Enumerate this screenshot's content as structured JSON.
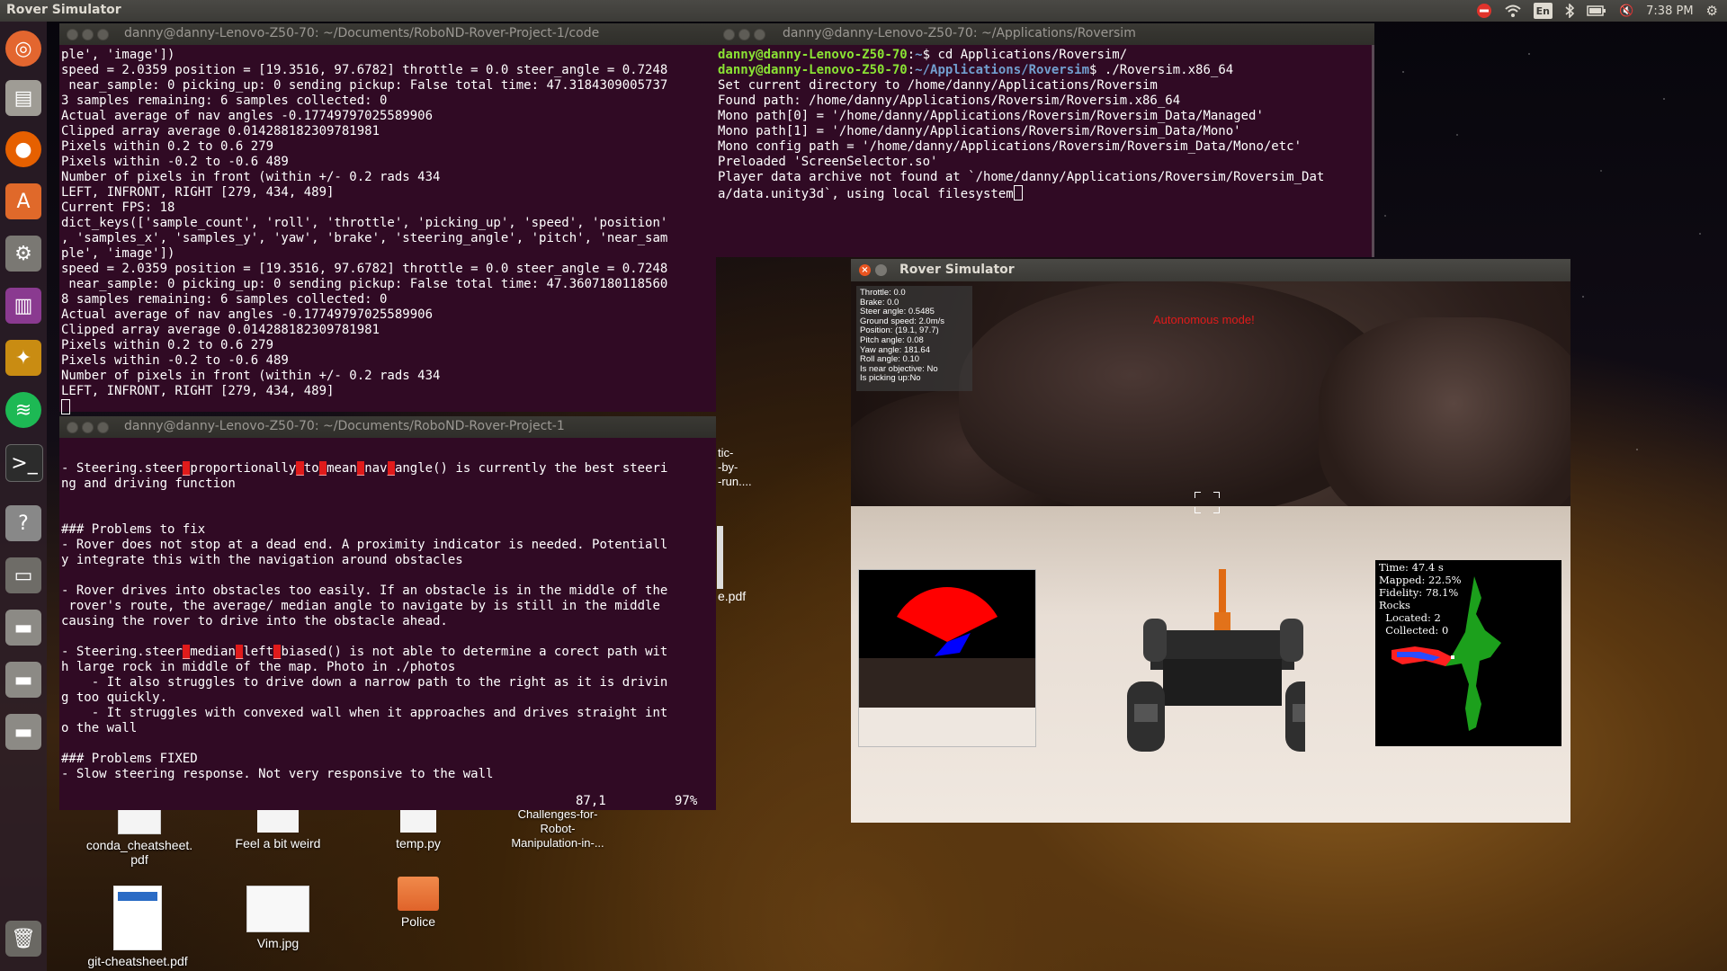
{
  "top_panel": {
    "app_title": "Rover Simulator",
    "keyboard_layout": "En",
    "time": "7:38 PM"
  },
  "launcher": {
    "items": [
      "ubuntu-dash-icon",
      "files-icon",
      "firefox-icon",
      "software-center-icon",
      "settings-icon",
      "workspace-icon",
      "puzzle-icon",
      "spotify-icon",
      "terminal-icon",
      "help-icon",
      "window-icon",
      "drive-icon",
      "drive-icon",
      "drive-icon",
      "trash-icon"
    ]
  },
  "term1": {
    "title": "danny@danny-Lenovo-Z50-70: ~/Documents/RoboND-Rover-Project-1/code",
    "lines": [
      "ple', 'image'])",
      "speed = 2.0359 position = [19.3516, 97.6782] throttle = 0.0 steer_angle = 0.7248",
      " near_sample: 0 picking_up: 0 sending pickup: False total time: 47.3184309005737",
      "3 samples remaining: 6 samples collected: 0",
      "Actual average of nav angles -0.17749797025589906",
      "Clipped array average 0.014288182309781981",
      "Pixels within 0.2 to 0.6 279",
      "Pixels within -0.2 to -0.6 489",
      "Number of pixels in front (within +/- 0.2 rads 434",
      "LEFT, INFRONT, RIGHT [279, 434, 489]",
      "Current FPS: 18",
      "dict_keys(['sample_count', 'roll', 'throttle', 'picking_up', 'speed', 'position'",
      ", 'samples_x', 'samples_y', 'yaw', 'brake', 'steering_angle', 'pitch', 'near_sam",
      "ple', 'image'])",
      "speed = 2.0359 position = [19.3516, 97.6782] throttle = 0.0 steer_angle = 0.7248",
      " near_sample: 0 picking_up: 0 sending pickup: False total time: 47.3607180118560",
      "8 samples remaining: 6 samples collected: 0",
      "Actual average of nav angles -0.17749797025589906",
      "Clipped array average 0.014288182309781981",
      "Pixels within 0.2 to 0.6 279",
      "Pixels within -0.2 to -0.6 489",
      "Number of pixels in front (within +/- 0.2 rads 434",
      "LEFT, INFRONT, RIGHT [279, 434, 489]"
    ]
  },
  "term2": {
    "title": "danny@danny-Lenovo-Z50-70: ~/Applications/Roversim",
    "prompt_user": "danny@danny-Lenovo-Z50-70",
    "cmd1_path": "~",
    "cmd1": "$ cd Applications/Roversim/",
    "cmd2_path": "~/Applications/Roversim",
    "cmd2": "$ ./Roversim.x86_64",
    "lines": [
      "Set current directory to /home/danny/Applications/Roversim",
      "Found path: /home/danny/Applications/Roversim/Roversim.x86_64",
      "Mono path[0] = '/home/danny/Applications/Roversim/Roversim_Data/Managed'",
      "Mono path[1] = '/home/danny/Applications/Roversim/Roversim_Data/Mono'",
      "Mono config path = '/home/danny/Applications/Roversim/Roversim_Data/Mono/etc'",
      "Preloaded 'ScreenSelector.so'",
      "Player data archive not found at `/home/danny/Applications/Roversim/Roversim_Dat"
    ],
    "last_line": "a/data.unity3d`, using local filesystem"
  },
  "term3": {
    "title": "danny@danny-Lenovo-Z50-70: ~/Documents/RoboND-Rover-Project-1",
    "status_pos": "87,1",
    "status_pct": "97%",
    "lines": [
      "",
      "- Steering.steer_proportionally_to_mean_nav_angle() is currently the best steeri",
      "ng and driving function",
      "",
      "",
      "### Problems to fix",
      "- Rover does not stop at a dead end. A proximity indicator is needed. Potentiall",
      "y integrate this with the navigation around obstacles",
      "",
      "- Rover drives into obstacles too easily. If an obstacle is in the middle of the",
      " rover's route, the average/ median angle to navigate by is still in the middle",
      "causing the rover to drive into the obstacle ahead.",
      "",
      "- Steering.steer_median_left_biased() is not able to determine a corect path wit",
      "h large rock in middle of the map. Photo in ./photos",
      "    - It also struggles to drive down a narrow path to the right as it is drivin",
      "g too quickly.",
      "    - It struggles with convexed wall when it approaches and drives straight int",
      "o the wall",
      "",
      "### Problems FIXED",
      "- Slow steering response. Not very responsive to the wall"
    ]
  },
  "partial_desktop": {
    "line1": "tic-",
    "line2": "-by-",
    "line3": "-run....",
    "pdf": "e.pdf"
  },
  "simulator": {
    "title": "Rover Simulator",
    "mode": "Autonomous mode!",
    "hud": [
      "Throttle: 0.0",
      "Brake: 0.0",
      "Steer angle: 0.5485",
      "Ground speed: 2.0m/s",
      "Position: (19.1, 97.7)",
      "Pitch angle: 0.08",
      "Yaw angle: 181.64",
      "Roll angle: 0.10",
      "Is near objective: No",
      "Is picking up:No"
    ],
    "map_stats": [
      "Time: 47.4 s",
      "Mapped: 22.5%",
      "Fidelity: 78.1%",
      "Rocks",
      "  Located: 2",
      "  Collected: 0"
    ]
  },
  "desktop_icons": [
    {
      "label": "conda_cheatsheet.\npdf"
    },
    {
      "label": "Feel a bit weird"
    },
    {
      "label": "temp.py"
    },
    {
      "label": "Challenges-for-\nRobot-\nManipulation-in-..."
    },
    {
      "label": "git-cheatsheet.pdf"
    },
    {
      "label": "Vim.jpg"
    },
    {
      "label": "Police"
    }
  ]
}
